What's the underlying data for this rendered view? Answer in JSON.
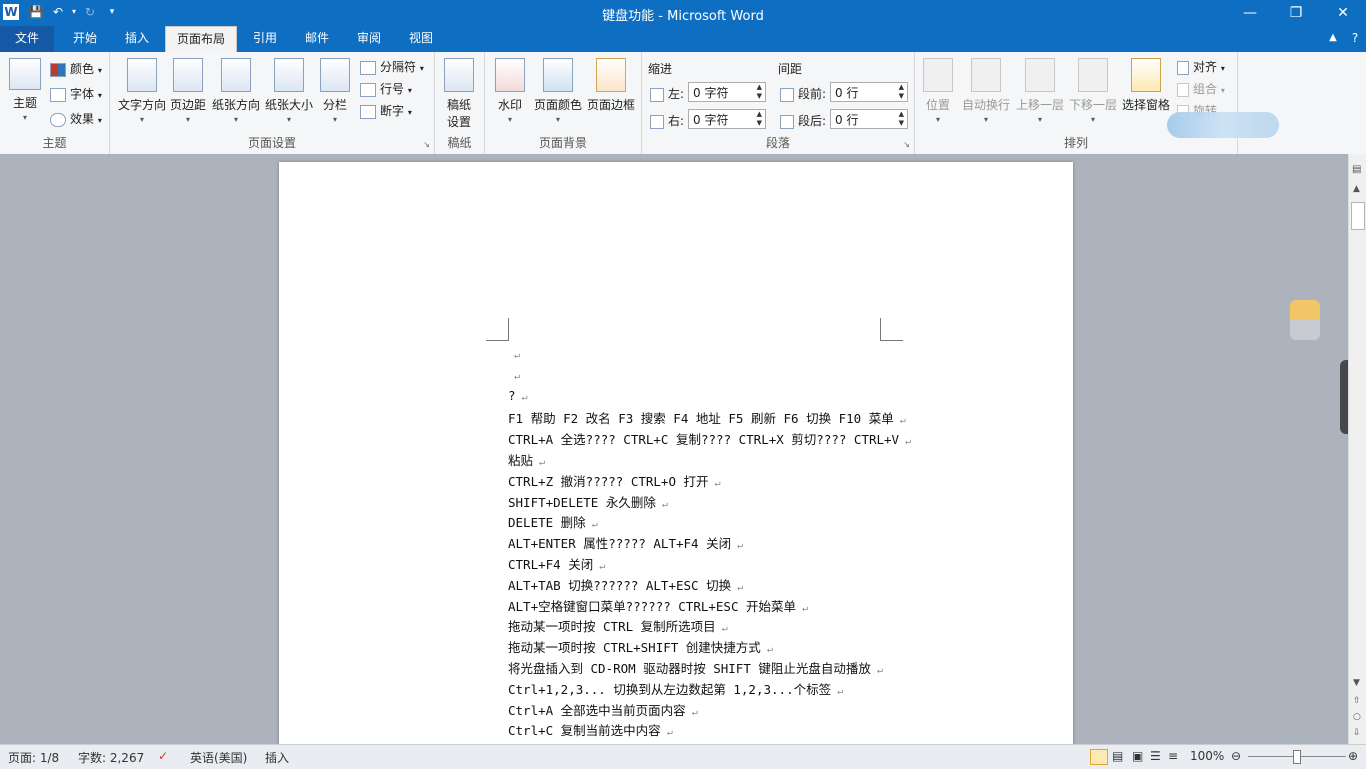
{
  "window": {
    "title": "键盘功能 - Microsoft Word"
  },
  "tabs": {
    "file": "文件",
    "home": "开始",
    "insert": "插入",
    "layout": "页面布局",
    "references": "引用",
    "mailings": "邮件",
    "review": "审阅",
    "view": "视图"
  },
  "ribbon": {
    "theme": {
      "themes": "主题",
      "colors": "颜色",
      "fonts": "字体",
      "effects": "效果",
      "group": "主题"
    },
    "page_setup": {
      "text_direction": "文字方向",
      "margins": "页边距",
      "orientation": "纸张方向",
      "size": "纸张大小",
      "columns": "分栏",
      "breaks": "分隔符",
      "line_numbers": "行号",
      "hyphenation": "断字",
      "group": "页面设置"
    },
    "manuscript": {
      "settings_line1": "稿纸",
      "settings_line2": "设置",
      "group": "稿纸"
    },
    "background": {
      "watermark": "水印",
      "page_color": "页面颜色",
      "page_borders": "页面边框",
      "group": "页面背景"
    },
    "paragraph": {
      "indent": "缩进",
      "spacing": "间距",
      "left_label": "左:",
      "left_value": "0 字符",
      "right_label": "右:",
      "right_value": "0 字符",
      "before_label": "段前:",
      "before_value": "0 行",
      "after_label": "段后:",
      "after_value": "0 行",
      "group": "段落"
    },
    "arrange": {
      "position": "位置",
      "wrap_text": "自动换行",
      "bring_forward": "上移一层",
      "send_backward": "下移一层",
      "selection_pane": "选择窗格",
      "align": "对齐",
      "group_btn": "组合",
      "rotate": "旋转",
      "group": "排列"
    }
  },
  "document": {
    "lines": [
      "",
      "",
      "?",
      "F1 帮助 F2 改名 F3 搜索 F4 地址 F5 刷新 F6 切换 F10 菜单",
      "CTRL+A 全选???? CTRL+C 复制???? CTRL+X 剪切???? CTRL+V",
      "粘贴",
      "CTRL+Z 撤消????? CTRL+O 打开",
      "SHIFT+DELETE 永久删除",
      "DELETE 删除",
      "ALT+ENTER 属性????? ALT+F4 关闭",
      "CTRL+F4 关闭",
      "ALT+TAB 切换?????? ALT+ESC 切换",
      "ALT+空格键窗口菜单?????? CTRL+ESC 开始菜单",
      "拖动某一项时按 CTRL 复制所选项目",
      "拖动某一项时按 CTRL+SHIFT 创建快捷方式",
      "将光盘插入到 CD-ROM 驱动器时按 SHIFT 键阻止光盘自动播放",
      "Ctrl+1,2,3...   切换到从左边数起第 1,2,3...个标签",
      "Ctrl+A   全部选中当前页面内容",
      "Ctrl+C   复制当前选中内容"
    ]
  },
  "status": {
    "page": "页面: 1/8",
    "words": "字数: 2,267",
    "language": "英语(美国)",
    "mode": "插入",
    "zoom": "100%"
  }
}
